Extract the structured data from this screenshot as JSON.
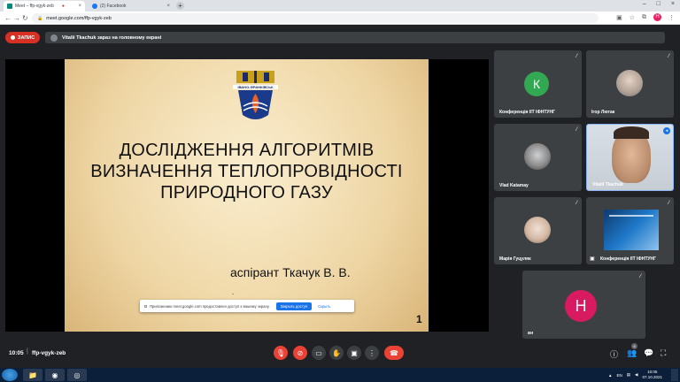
{
  "browser": {
    "tabs": [
      {
        "title": "Meet – ffp-vgyk-zeb",
        "active": true
      },
      {
        "title": "(2) Facebook",
        "active": false
      }
    ],
    "url": "meet.google.com/ffp-vgyk-zeb",
    "profile_initial": "H"
  },
  "meet": {
    "recording_label": "ЗАПИС",
    "presenter_banner": "Vitalii Tkachuk зараз на головному екрані",
    "slide": {
      "title_lines": [
        "ДОСЛІДЖЕННЯ АЛГОРИТМІВ",
        "ВИЗНАЧЕННЯ ТЕПЛОПРОВІДНОСТІ",
        "ПРИРОДНОГО ГАЗУ"
      ],
      "author": "аспірант Ткачук В. В.",
      "dot": ".",
      "page_number": "1",
      "logo_text": "ІВАНО-ФРАНКІВСЬК"
    },
    "share_bar": {
      "text": "Приложению meet.google.com предоставлен доступ к вашему экрану.",
      "stop_label": "Закрыть доступ",
      "hide_label": "Скрыть"
    },
    "participants": [
      {
        "name": "Конференція ІІТ ІФНТУНГ",
        "initial": "К",
        "avatar_color": "#33a852"
      },
      {
        "name": "Ігор Лютак",
        "initial": "",
        "avatar_color": "#9aa0a6"
      },
      {
        "name": "Vlad Katamay",
        "initial": "",
        "avatar_color": "#c9cbcf"
      },
      {
        "name": "Vitalii Tkachuk",
        "initial": "",
        "avatar_color": "#b89478"
      },
      {
        "name": "Марія Гуцуляк",
        "initial": "",
        "avatar_color": "#d9c2b0"
      },
      {
        "name": "Конференція ІІТ ІФНТУНГ",
        "initial": "",
        "avatar_color": "#1e6fb8"
      },
      {
        "name": "вн",
        "initial": "Н",
        "avatar_color": "#d81b60"
      }
    ],
    "bottom": {
      "time": "10:05",
      "separator": "|",
      "meeting_code": "ffp-vgyk-zeb",
      "participant_count": "8"
    }
  },
  "taskbar": {
    "language": "EN",
    "clock_time": "10:05",
    "clock_date": "07.10.2021"
  }
}
